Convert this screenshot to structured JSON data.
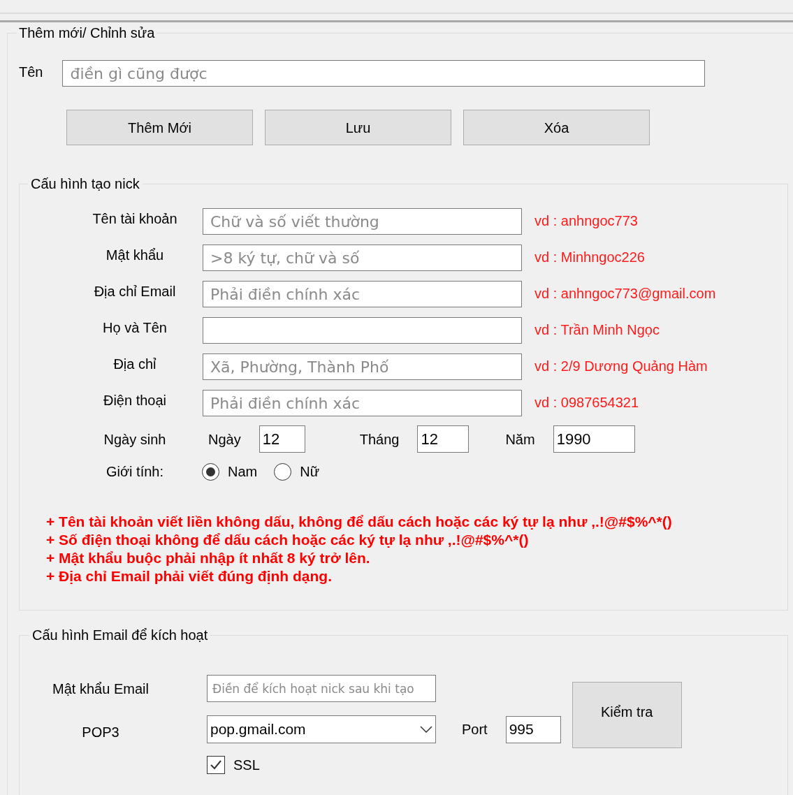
{
  "group_edit": {
    "title": "Thêm mới/ Chỉnh sửa",
    "name_label": "Tên",
    "name_placeholder": "điền gì cũng được",
    "buttons": [
      "Thêm Mới",
      "Lưu",
      "Xóa"
    ]
  },
  "group_account": {
    "title": "Cấu hình tạo nick",
    "fields": [
      {
        "label": "Tên tài khoản",
        "placeholder": "Chữ và số viết thường",
        "example": "vd : anhngoc773"
      },
      {
        "label": "Mật khẩu",
        "placeholder": ">8 ký tự, chữ và số",
        "example": "vd : Minhngoc226"
      },
      {
        "label": "Địa chỉ Email",
        "placeholder": "Phải điền chính xác",
        "example": "vd : anhngoc773@gmail.com"
      },
      {
        "label": "Họ và Tên",
        "example": "vd : Trần Minh Ngọc"
      },
      {
        "label": "Địa chỉ",
        "placeholder": "Xã, Phường, Thành Phố",
        "example": "vd : 2/9 Dương Quảng Hàm"
      },
      {
        "label": "Điện thoại",
        "placeholder": "Phải điền chính xác",
        "example": "vd : 0987654321"
      }
    ],
    "birth": {
      "label": "Ngày sinh",
      "parts": [
        {
          "label": "Ngày",
          "value": "12"
        },
        {
          "label": "Tháng",
          "value": "12"
        },
        {
          "label": "Năm",
          "value": "1990"
        }
      ]
    },
    "gender": {
      "label": "Giới tính:",
      "options": [
        {
          "label": "Nam",
          "selected": true
        },
        {
          "label": "Nữ",
          "selected": false
        }
      ]
    },
    "notes": [
      "+ Tên tài khoản viết liền không dấu, không để dấu cách hoặc các ký tự lạ như ,.!@#$%^*()",
      "+ Số điện thoại không để dấu cách hoặc các ký tự lạ như ,.!@#$%^*()",
      "+ Mật khẩu buộc phải nhập ít nhất 8 ký trở lên.",
      "+ Địa chỉ Email phải viết đúng định dạng."
    ]
  },
  "group_email": {
    "title": "Cấu hình Email để kích hoạt",
    "password_label": "Mật khẩu Email",
    "password_placeholder": "Điền để kích hoạt nick sau khi tạo",
    "pop3_label": "POP3",
    "pop3_value": "pop.gmail.com",
    "port_label": "Port",
    "port_value": "995",
    "check_button": "Kiểm tra",
    "ssl": {
      "label": "SSL",
      "checked": true
    }
  }
}
